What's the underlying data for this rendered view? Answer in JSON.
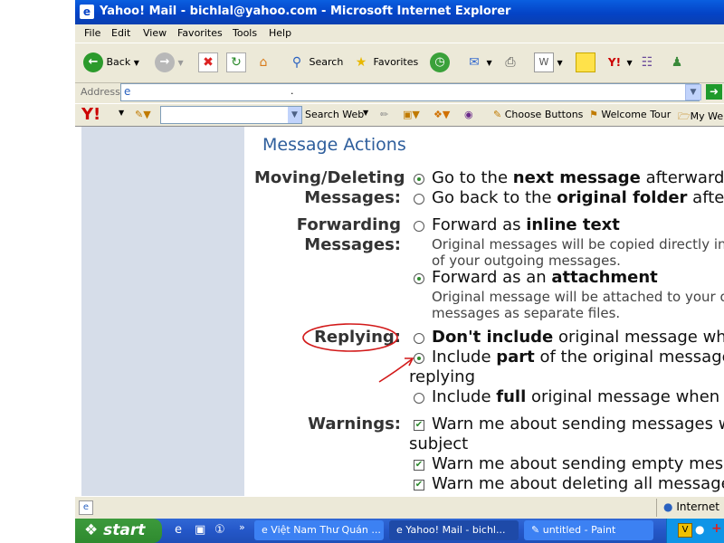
{
  "window": {
    "title": "Yahoo! Mail - bichlal@yahoo.com - Microsoft Internet Explorer"
  },
  "menu": [
    "File",
    "Edit",
    "View",
    "Favorites",
    "Tools",
    "Help"
  ],
  "toolbar": {
    "back": "Back",
    "search": "Search",
    "favorites": "Favorites"
  },
  "address": {
    "label": "Address",
    "value": "."
  },
  "yahoo_bar": {
    "search_web": "Search Web",
    "choose_buttons": "Choose Buttons",
    "welcome_tour": "Welcome Tour",
    "my_web": "My Web"
  },
  "page": {
    "section_title": "Message Actions",
    "moving": {
      "label_1": "Moving/Deleting",
      "label_2": "Messages:",
      "opt1_a": "Go to the ",
      "opt1_b": "next message",
      "opt1_c": " afterwards",
      "opt2_a": "Go back to the ",
      "opt2_b": "original folder",
      "opt2_c": " afterwards"
    },
    "forwarding": {
      "label_1": "Forwarding",
      "label_2": "Messages:",
      "opt1_a": "Forward as ",
      "opt1_b": "inline text",
      "opt1_desc_1": "Original messages will be copied directly into the text",
      "opt1_desc_2": "of your outgoing messages.",
      "opt2_a": "Forward as an ",
      "opt2_b": "attachment",
      "opt2_desc_1": "Original message will be attached to your outgoing",
      "opt2_desc_2": "messages as separate files."
    },
    "replying": {
      "label": "Replying:",
      "opt1_a": "Don't include",
      "opt1_b": " original message when replying",
      "opt2_a": "Include ",
      "opt2_b": "part",
      "opt2_c": " of the original message when",
      "opt2_d": "replying",
      "opt3_a": "Include ",
      "opt3_b": "full",
      "opt3_c": " original message when replying"
    },
    "warnings": {
      "label": "Warnings:",
      "opt1_a": "Warn me about sending messages without a",
      "opt1_b": "subject",
      "opt2": "Warn me about sending empty messages",
      "opt3": "Warn me about deleting all messages"
    }
  },
  "status": {
    "zone": "Internet"
  },
  "taskbar": {
    "start": "start",
    "tasks": [
      "Việt Nam Thư Quán ...",
      "Yahoo! Mail - bichl...",
      "untitled - Paint"
    ]
  },
  "colors": {
    "title_blue": "#0443c6",
    "section_blue": "#2e5e9c",
    "annotation_red": "#d21919"
  }
}
